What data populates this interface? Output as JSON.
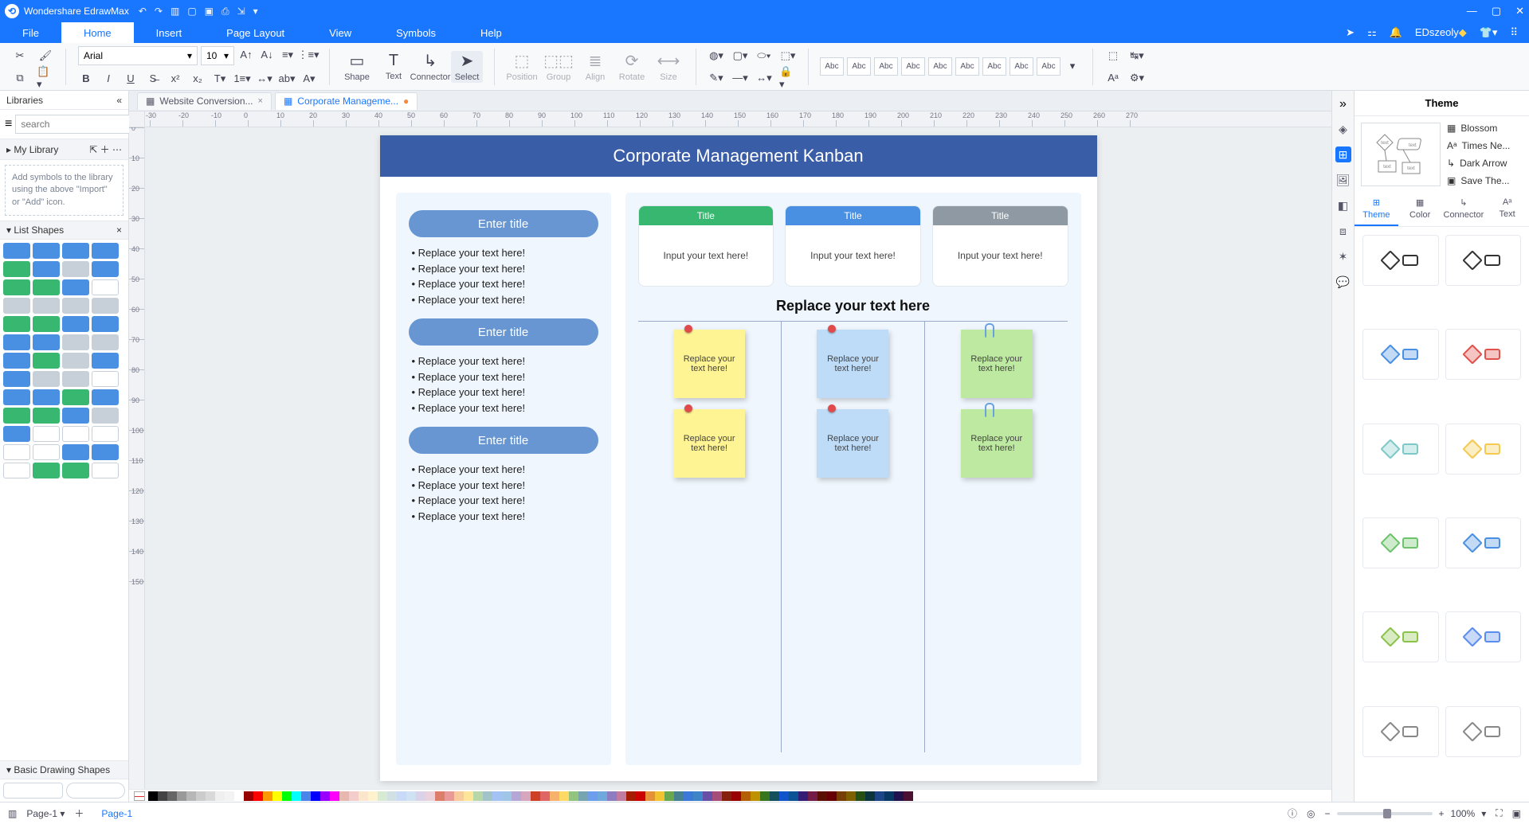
{
  "app": {
    "title": "Wondershare EdrawMax"
  },
  "menu": {
    "file": "File",
    "home": "Home",
    "insert": "Insert",
    "pagelayout": "Page Layout",
    "view": "View",
    "symbols": "Symbols",
    "help": "Help",
    "user": "EDszeoly"
  },
  "ribbon": {
    "font": "Arial",
    "size": "10",
    "shape": "Shape",
    "text": "Text",
    "connector": "Connector",
    "select": "Select",
    "position": "Position",
    "group": "Group",
    "align": "Align",
    "rotate": "Rotate",
    "size_lbl": "Size",
    "abc": "Abc"
  },
  "left": {
    "title": "Libraries",
    "search": "search",
    "mylib": "My Library",
    "mylib_hint": "Add symbols to the library using the above \"Import\" or \"Add\" icon.",
    "list": "List Shapes",
    "basic": "Basic Drawing Shapes"
  },
  "tabs": {
    "t1": "Website Conversion...",
    "t2": "Corporate Manageme..."
  },
  "doc": {
    "title": "Corporate Management Kanban",
    "enter": "Enter title",
    "replace_line": "Replace your text here!",
    "card_title": "Title",
    "card_body": "Input your text here!",
    "h3": "Replace your text here",
    "note": "Replace your text here!"
  },
  "theme": {
    "title": "Theme",
    "blossom": "Blossom",
    "times": "Times Ne...",
    "dark": "Dark Arrow",
    "save": "Save The...",
    "tab_theme": "Theme",
    "tab_color": "Color",
    "tab_conn": "Connector",
    "tab_text": "Text"
  },
  "status": {
    "page": "Page-1",
    "page2": "Page-1",
    "zoom": "100%"
  },
  "ruler_h": [
    "-30",
    "-20",
    "-10",
    "0",
    "10",
    "20",
    "30",
    "40",
    "50",
    "60",
    "70",
    "80",
    "90",
    "100",
    "110",
    "120",
    "130",
    "140",
    "150",
    "160",
    "170",
    "180",
    "190",
    "200",
    "210",
    "220",
    "230",
    "240",
    "250",
    "260",
    "270"
  ],
  "ruler_v": [
    "0",
    "10",
    "20",
    "30",
    "40",
    "50",
    "60",
    "70",
    "80",
    "90",
    "100",
    "110",
    "120",
    "130",
    "140",
    "150"
  ]
}
